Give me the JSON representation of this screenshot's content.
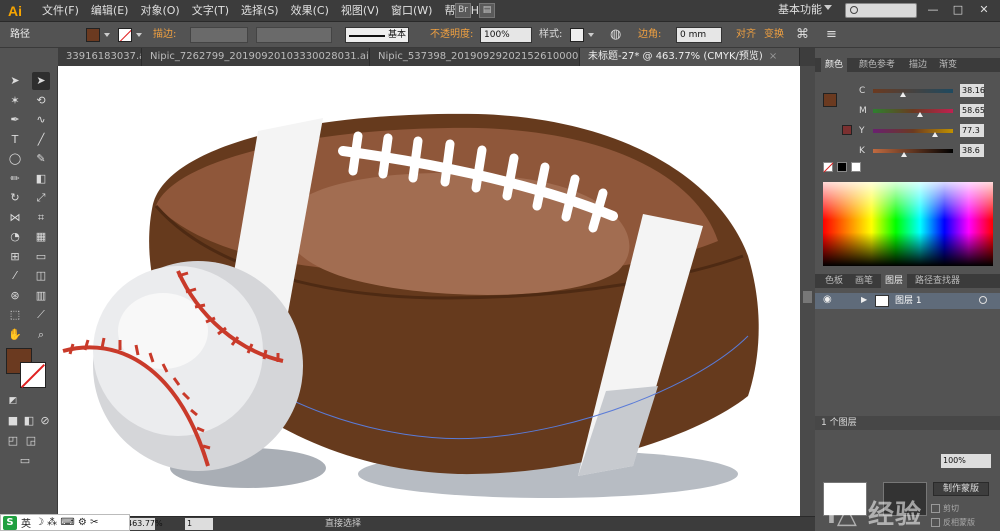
{
  "app": {
    "logo": "Ai",
    "workspace": "基本功能"
  },
  "menu": [
    "文件(F)",
    "编辑(E)",
    "对象(O)",
    "文字(T)",
    "选择(S)",
    "效果(C)",
    "视图(V)",
    "窗口(W)",
    "帮助(H)"
  ],
  "menu_icons": {
    "br": "Br",
    "layout": "▤"
  },
  "window_controls": {
    "min": "—",
    "max": "□",
    "close": "✕"
  },
  "control_bar": {
    "object_type": "路径",
    "stroke_label": "描边:",
    "line_style": "基本",
    "opacity_label": "不透明度:",
    "opacity_value": "100%",
    "style_label": "样式:",
    "corner_label": "边角:",
    "corner_value": "0 mm",
    "align_label": "对齐",
    "transform_label": "变换"
  },
  "tabs": [
    {
      "label": "33916183037.ai*",
      "active": false,
      "close": "×"
    },
    {
      "label": "Nipic_7262799_20190920103330028031.ai*",
      "active": false,
      "close": "×"
    },
    {
      "label": "Nipic_537398_20190929202152610000.ai*",
      "active": false,
      "close": "×"
    },
    {
      "label": "未标题-27* @ 463.77% (CMYK/预览)",
      "active": true,
      "close": "×"
    }
  ],
  "tools": [
    {
      "name": "selection-tool",
      "glyph": "➤"
    },
    {
      "name": "direct-selection-tool",
      "glyph": "➤"
    },
    {
      "name": "magic-wand-tool",
      "glyph": "✶"
    },
    {
      "name": "lasso-tool",
      "glyph": "⟲"
    },
    {
      "name": "pen-tool",
      "glyph": "✒"
    },
    {
      "name": "curvature-tool",
      "glyph": "∿"
    },
    {
      "name": "type-tool",
      "glyph": "T"
    },
    {
      "name": "line-tool",
      "glyph": "╱"
    },
    {
      "name": "ellipse-tool",
      "glyph": "◯"
    },
    {
      "name": "paintbrush-tool",
      "glyph": "✎"
    },
    {
      "name": "pencil-tool",
      "glyph": "✏"
    },
    {
      "name": "eraser-tool",
      "glyph": "◧"
    },
    {
      "name": "rotate-tool",
      "glyph": "↻"
    },
    {
      "name": "scale-tool",
      "glyph": "⤢"
    },
    {
      "name": "width-tool",
      "glyph": "⋈"
    },
    {
      "name": "free-transform-tool",
      "glyph": "⌗"
    },
    {
      "name": "shape-builder-tool",
      "glyph": "◔"
    },
    {
      "name": "perspective-grid-tool",
      "glyph": "▦"
    },
    {
      "name": "mesh-tool",
      "glyph": "⊞"
    },
    {
      "name": "gradient-tool",
      "glyph": "▭"
    },
    {
      "name": "eyedropper-tool",
      "glyph": "⁄"
    },
    {
      "name": "blend-tool",
      "glyph": "◫"
    },
    {
      "name": "symbol-sprayer-tool",
      "glyph": "⊛"
    },
    {
      "name": "column-graph-tool",
      "glyph": "▥"
    },
    {
      "name": "artboard-tool",
      "glyph": "⬚"
    },
    {
      "name": "slice-tool",
      "glyph": "⟋"
    },
    {
      "name": "hand-tool",
      "glyph": "✋"
    },
    {
      "name": "zoom-tool",
      "glyph": "⌕"
    }
  ],
  "colors": {
    "fill": "#6b3a20",
    "stroke": "#ffffff"
  },
  "status_bar": {
    "zoom": "463.77%",
    "page": "1",
    "status": "直接选择"
  },
  "ime": {
    "logo": "S",
    "lang": "英",
    "icons": "☽ ⁂ ⌨ ⚙ ✂"
  },
  "panels": {
    "color_tabs": [
      "颜色",
      "颜色参考",
      "描边",
      "渐变"
    ],
    "cmyk": [
      {
        "label": "C",
        "value": "38.16",
        "pos": 0.38,
        "grad": "linear-gradient(to right,#6b3a20,#1f4a60)"
      },
      {
        "label": "M",
        "value": "58.65",
        "pos": 0.59,
        "grad": "linear-gradient(to right,#2e8030,#6b3a20,#c02050)"
      },
      {
        "label": "Y",
        "value": "77.3",
        "pos": 0.77,
        "grad": "linear-gradient(to right,#6a2070,#6b3a20,#c09000)"
      },
      {
        "label": "K",
        "value": "38.6",
        "pos": 0.39,
        "grad": "linear-gradient(to right,#c06a40,#000000)"
      }
    ],
    "layer_tabs": [
      "色板",
      "画笔",
      "图层",
      "路径查找器"
    ],
    "layer_name": "图层 1",
    "layers_count": "1 个图层",
    "transparency": {
      "value": "100%",
      "make_mask": "制作蒙版",
      "clip": "剪切",
      "invert_mask": "反相蒙版"
    },
    "watermark": "i△ 经验"
  }
}
